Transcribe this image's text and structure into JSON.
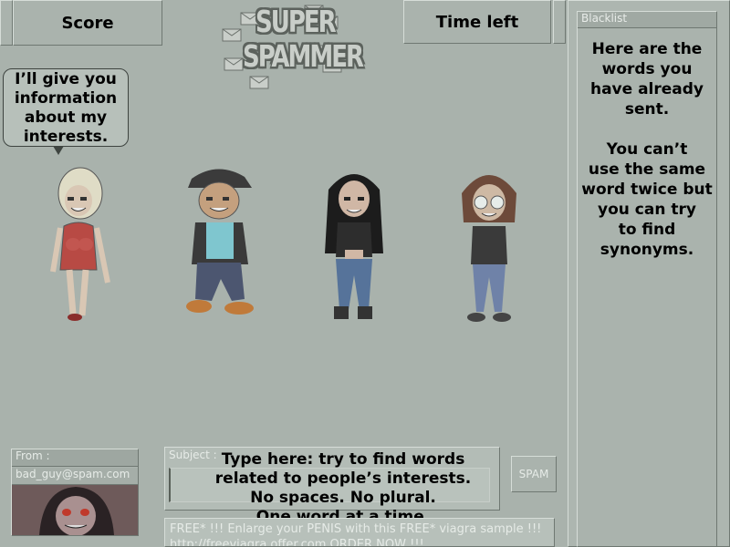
{
  "header": {
    "score_label": "Score",
    "time_label": "Time left"
  },
  "logo": {
    "line1": "SUPER",
    "line2": "SPAMMER"
  },
  "bubble": {
    "text": "I’ll give you\ninformation\nabout my\ninterests."
  },
  "blacklist": {
    "title": "Blacklist",
    "text": "Here are the\nwords you\nhave already\nsent.\n\nYou can’t\nuse the same\nword twice but\nyou can try\nto find\nsynonyms."
  },
  "characters": [
    {
      "name": "blonde-woman"
    },
    {
      "name": "cap-guy"
    },
    {
      "name": "goth-girl"
    },
    {
      "name": "glasses-guy"
    }
  ],
  "email": {
    "from_label": "From :",
    "from_value": "bad_guy@spam.com",
    "subject_label": "Subject :",
    "subject_hint": "Type here: try to find words\nrelated to people’s interests.\nNo spaces. No plural.\nOne word at a time.",
    "spam_label": "SPAM",
    "body": "FREE* !!! Enlarge your PENIS with this FREE* viagra sample !!! http://freeviagra.offer.com ORDER NOW !!!"
  }
}
